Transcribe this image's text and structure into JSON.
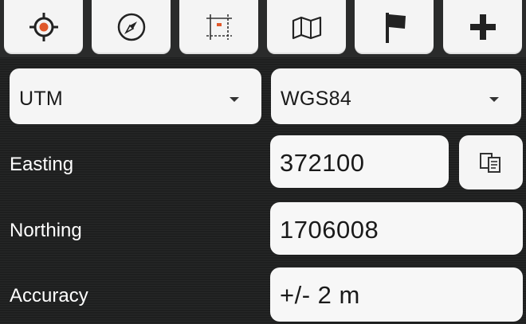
{
  "toolbar": {
    "buttons": [
      {
        "icon": "crosshair-icon"
      },
      {
        "icon": "compass-icon"
      },
      {
        "icon": "area-select-icon"
      },
      {
        "icon": "map-icon"
      },
      {
        "icon": "flag-icon"
      },
      {
        "icon": "plus-icon"
      }
    ],
    "accent_color": "#e0582a"
  },
  "coordinate_system": {
    "selected": "UTM"
  },
  "datum": {
    "selected": "WGS84"
  },
  "rows": {
    "easting": {
      "label": "Easting",
      "value": "372100"
    },
    "northing": {
      "label": "Northing",
      "value": "1706008"
    },
    "accuracy": {
      "label": "Accuracy",
      "value": "+/- 2 m"
    }
  },
  "copy_button": {
    "icon": "copy-icon"
  }
}
